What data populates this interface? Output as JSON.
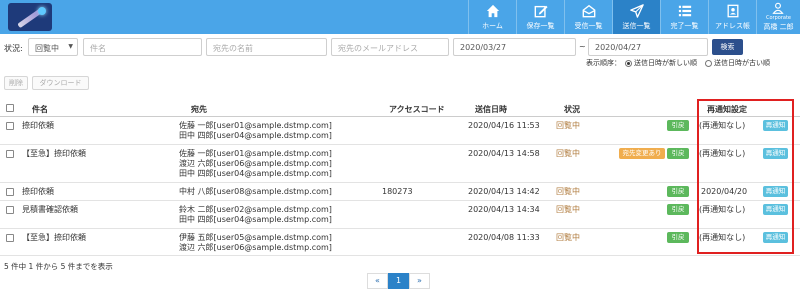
{
  "nav": {
    "items": [
      {
        "label": "ホーム",
        "icon": "home-icon"
      },
      {
        "label": "保存一覧",
        "icon": "edit-icon"
      },
      {
        "label": "受信一覧",
        "icon": "inbox-icon"
      },
      {
        "label": "送信一覧",
        "icon": "send-icon"
      },
      {
        "label": "完了一覧",
        "icon": "list-icon"
      },
      {
        "label": "アドレス帳",
        "icon": "address-book-icon"
      }
    ],
    "user": {
      "company": "Corporate",
      "name": "高橋 二郎"
    }
  },
  "search": {
    "label": "状況:",
    "status_value": "回覧中",
    "name_placeholder": "件名",
    "recipient_placeholder": "宛先の名前",
    "email_placeholder": "宛先のメールアドレス",
    "date_from": "2020/03/27",
    "tilde": "~",
    "date_to": "2020/04/27",
    "button": "検索"
  },
  "order": {
    "label": "表示順序：",
    "option_new": "送信日時が新しい順",
    "option_old": "送信日時が古い順"
  },
  "actions": {
    "delete": "削除",
    "download": "ダウンロード"
  },
  "table": {
    "headers": {
      "subject": "件名",
      "recipient": "宛先",
      "access_code": "アクセスコード",
      "sent_at": "送信日時",
      "status": "状況",
      "renotify": "再通知設定"
    },
    "rows": [
      {
        "subject": "捺印依頼",
        "recipients": [
          "佐藤 一郎[user01@sample.dstmp.com]",
          "田中 四郎[user04@sample.dstmp.com]"
        ],
        "access_code": "",
        "sent_at": "2020/04/16 11:53",
        "status": "回覧中",
        "change_badge": "",
        "back_badge": "引戻し",
        "renotify": "(再通知なし)",
        "renotify_button": "再通知"
      },
      {
        "subject": "【至急】捺印依頼",
        "recipients": [
          "佐藤 一郎[user01@sample.dstmp.com]",
          "渡辺 六郎[user06@sample.dstmp.com]",
          "田中 四郎[user04@sample.dstmp.com]"
        ],
        "access_code": "",
        "sent_at": "2020/04/13 14:58",
        "status": "回覧中",
        "change_badge": "宛先変更あり",
        "back_badge": "引戻し",
        "renotify": "(再通知なし)",
        "renotify_button": "再通知"
      },
      {
        "subject": "捺印依頼",
        "recipients": [
          "中村 八郎[user08@sample.dstmp.com]"
        ],
        "access_code": "180273",
        "sent_at": "2020/04/13 14:42",
        "status": "回覧中",
        "change_badge": "",
        "back_badge": "引戻し",
        "renotify": "2020/04/20",
        "renotify_button": "再通知"
      },
      {
        "subject": "見積書確認依頼",
        "recipients": [
          "鈴木 二郎[user02@sample.dstmp.com]",
          "田中 四郎[user04@sample.dstmp.com]"
        ],
        "access_code": "",
        "sent_at": "2020/04/13 14:34",
        "status": "回覧中",
        "change_badge": "",
        "back_badge": "引戻し",
        "renotify": "(再通知なし)",
        "renotify_button": "再通知"
      },
      {
        "subject": "【至急】捺印依頼",
        "recipients": [
          "伊藤 五郎[user05@sample.dstmp.com]",
          "渡辺 六郎[user06@sample.dstmp.com]"
        ],
        "access_code": "",
        "sent_at": "2020/04/08 11:33",
        "status": "回覧中",
        "change_badge": "",
        "back_badge": "引戻し",
        "renotify": "(再通知なし)",
        "renotify_button": "再通知"
      }
    ]
  },
  "footer": {
    "summary": "5 件中 1 件から 5 件までを表示"
  },
  "pager": {
    "prev": "«",
    "current": "1",
    "next": "»"
  },
  "colors": {
    "header": "#4aa5e8",
    "active_nav": "#2b82c8",
    "search_button": "#2c4f8c",
    "highlight": "#e02020"
  }
}
